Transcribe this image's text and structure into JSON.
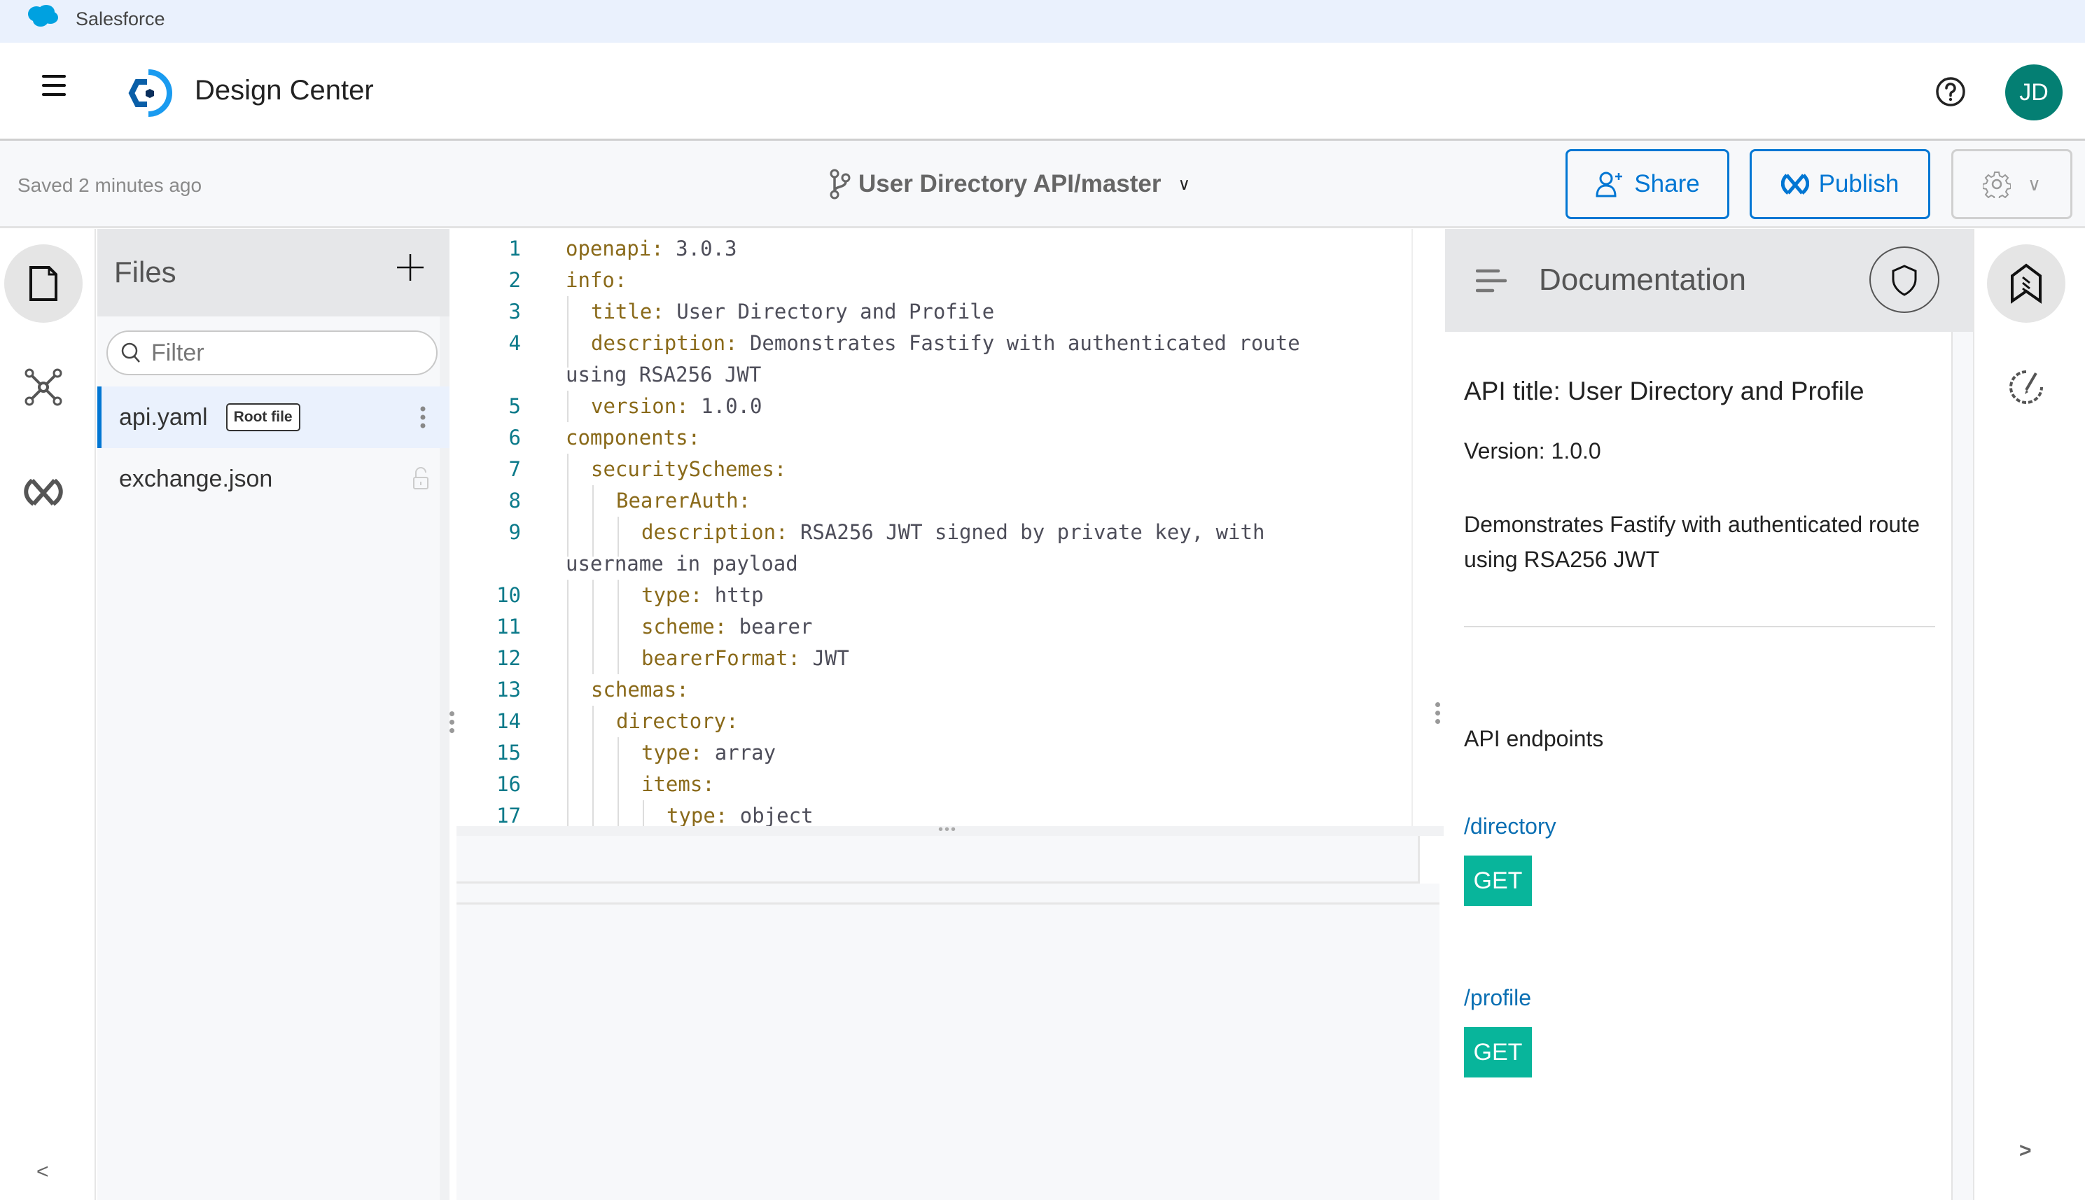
{
  "system_bar": {
    "brand": "Salesforce"
  },
  "header": {
    "app_title": "Design Center",
    "avatar_initials": "JD",
    "colors": {
      "avatar": "#047f73",
      "brand_blue": "#0176d3"
    }
  },
  "toolbar": {
    "saved_status": "Saved 2 minutes ago",
    "branch_label": "User Directory API/master",
    "share_label": "Share",
    "publish_label": "Publish"
  },
  "files_panel": {
    "title": "Files",
    "filter_placeholder": "Filter",
    "files": [
      {
        "name": "api.yaml",
        "badge": "Root file",
        "active": true
      },
      {
        "name": "exchange.json",
        "locked": true
      }
    ]
  },
  "editor": {
    "lines": [
      {
        "n": "1",
        "indent": 0,
        "key": "openapi:",
        "value": " 3.0.3"
      },
      {
        "n": "2",
        "indent": 0,
        "key": "info:",
        "value": ""
      },
      {
        "n": "3",
        "indent": 1,
        "key": "title:",
        "value": " User Directory and Profile"
      },
      {
        "n": "4",
        "indent": 1,
        "key": "description:",
        "value": " Demonstrates Fastify with authenticated route"
      },
      {
        "n": "",
        "indent": 0,
        "key": "",
        "value": "using RSA256 JWT",
        "wrap": true
      },
      {
        "n": "5",
        "indent": 1,
        "key": "version:",
        "value": " 1.0.0"
      },
      {
        "n": "6",
        "indent": 0,
        "key": "components:",
        "value": ""
      },
      {
        "n": "7",
        "indent": 1,
        "key": "securitySchemes:",
        "value": ""
      },
      {
        "n": "8",
        "indent": 2,
        "key": "BearerAuth:",
        "value": ""
      },
      {
        "n": "9",
        "indent": 3,
        "key": "description:",
        "value": " RSA256 JWT signed by private key, with"
      },
      {
        "n": "",
        "indent": 0,
        "key": "",
        "value": "username in payload",
        "wrap": true
      },
      {
        "n": "10",
        "indent": 3,
        "key": "type:",
        "value": " http"
      },
      {
        "n": "11",
        "indent": 3,
        "key": "scheme:",
        "value": " bearer"
      },
      {
        "n": "12",
        "indent": 3,
        "key": "bearerFormat:",
        "value": " JWT"
      },
      {
        "n": "13",
        "indent": 1,
        "key": "schemas:",
        "value": ""
      },
      {
        "n": "14",
        "indent": 2,
        "key": "directory:",
        "value": ""
      },
      {
        "n": "15",
        "indent": 3,
        "key": "type:",
        "value": " array"
      },
      {
        "n": "16",
        "indent": 3,
        "key": "items:",
        "value": ""
      },
      {
        "n": "17",
        "indent": 4,
        "key": "type:",
        "value": " object"
      }
    ]
  },
  "documentation": {
    "title": "Documentation",
    "api_title": "API title: User Directory and Profile",
    "version": "Version: 1.0.0",
    "description": "Demonstrates Fastify with authenticated route using RSA256 JWT",
    "endpoints_title": "API endpoints",
    "endpoints": [
      {
        "path": "/directory",
        "method": "GET"
      },
      {
        "path": "/profile",
        "method": "GET"
      }
    ],
    "colors": {
      "get_badge": "#08b59b",
      "link": "#0a6fb3"
    }
  },
  "rails": {
    "collapse_left": "<",
    "collapse_right": ">"
  }
}
